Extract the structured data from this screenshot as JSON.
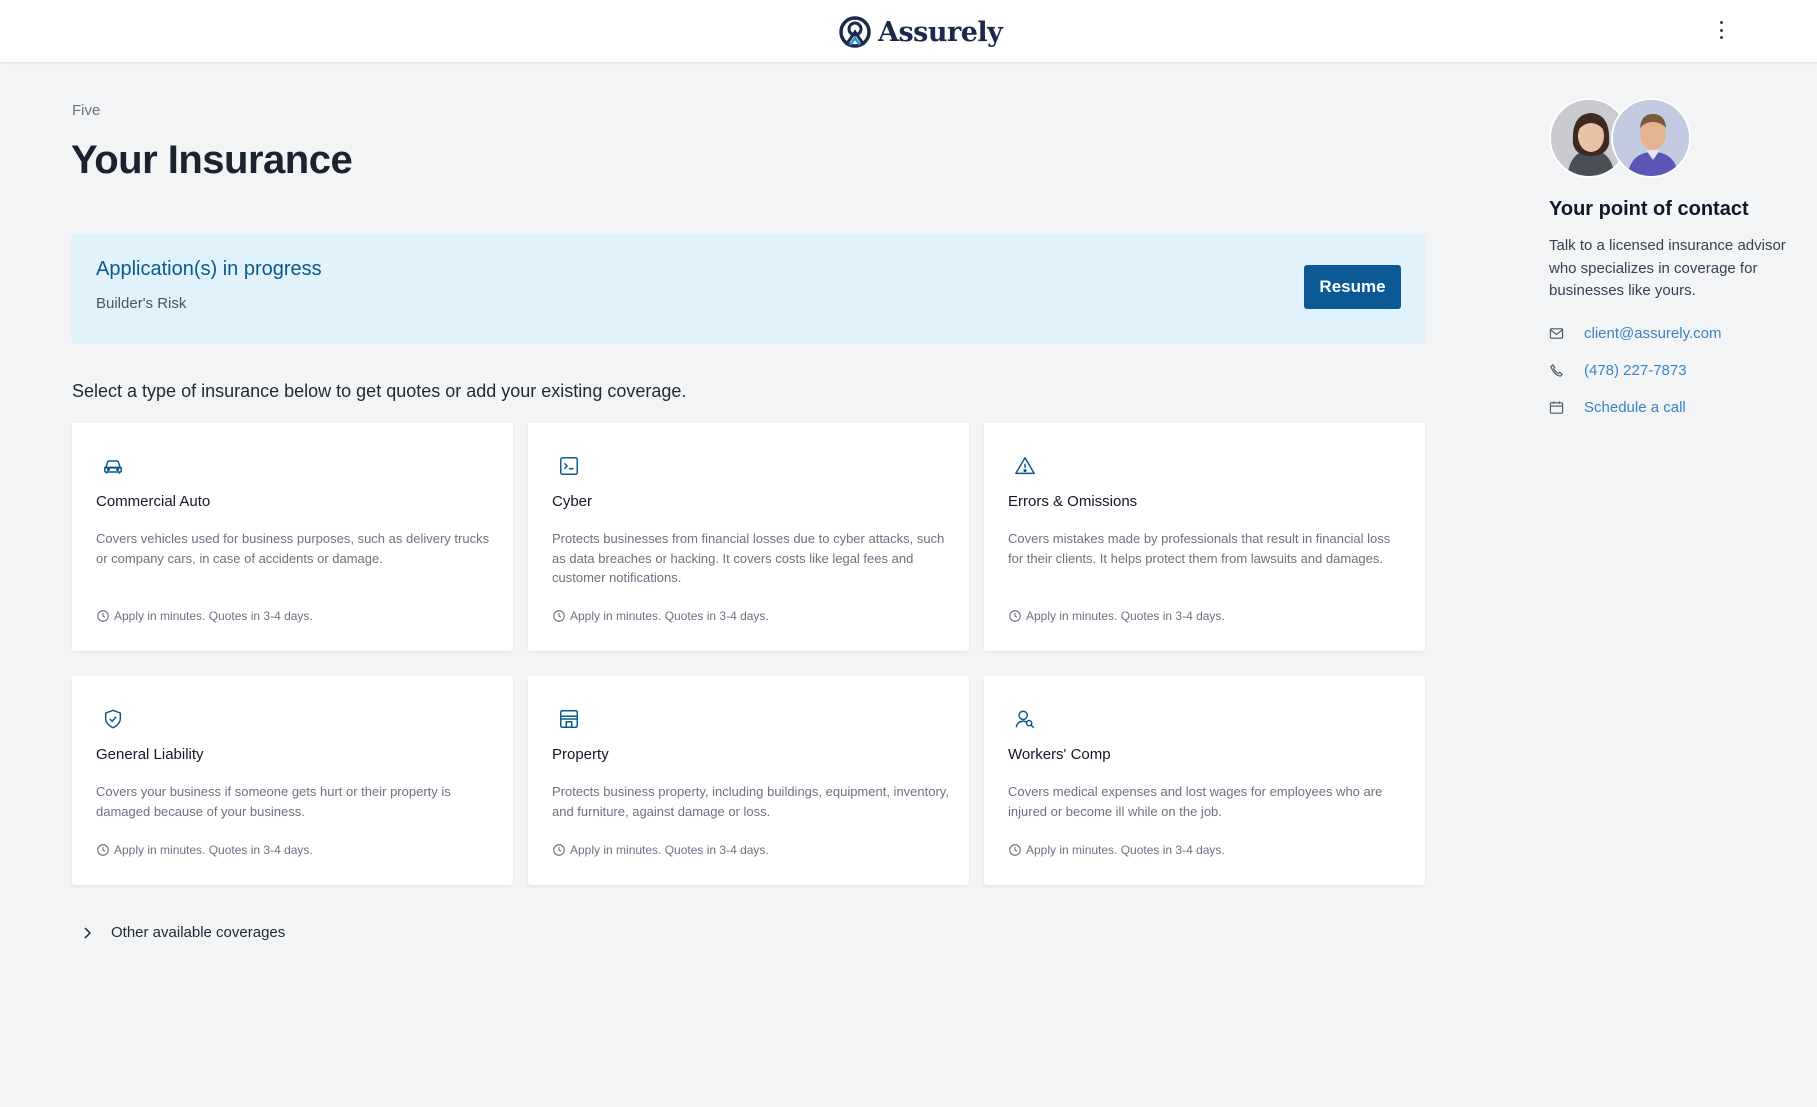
{
  "brand": {
    "name": "Assurely",
    "color": "#1b2a4a",
    "accent": "#0b5a96"
  },
  "header": {
    "menu_icon": "kebab-menu-icon"
  },
  "page": {
    "eyebrow": "Five",
    "title": "Your Insurance"
  },
  "in_progress": {
    "title": "Application(s) in progress",
    "subtitle": "Builder's Risk",
    "resume_label": "Resume"
  },
  "prompt": "Select a type of insurance below to get quotes or add your existing coverage.",
  "coverages": [
    {
      "icon": "car-icon",
      "title": "Commercial Auto",
      "description": "Covers vehicles used for business purposes, such as delivery trucks or company cars, in case of accidents or damage.",
      "footer": "Apply in minutes. Quotes in 3-4 days."
    },
    {
      "icon": "terminal-icon",
      "title": "Cyber",
      "description": "Protects businesses from financial losses due to cyber attacks, such as data breaches or hacking. It covers costs like legal fees and customer notifications.",
      "footer": "Apply in minutes. Quotes in 3-4 days."
    },
    {
      "icon": "warning-icon",
      "title": "Errors & Omissions",
      "description": "Covers mistakes made by professionals that result in financial loss for their clients. It helps protect them from lawsuits and damages.",
      "footer": "Apply in minutes. Quotes in 3-4 days."
    },
    {
      "icon": "shield-check-icon",
      "title": "General Liability",
      "description": "Covers your business if someone gets hurt or their property is damaged because of your business.",
      "footer": "Apply in minutes. Quotes in 3-4 days."
    },
    {
      "icon": "storefront-icon",
      "title": "Property",
      "description": "Protects business property, including buildings, equipment, inventory, and furniture, against damage or loss.",
      "footer": "Apply in minutes. Quotes in 3-4 days."
    },
    {
      "icon": "worker-icon",
      "title": "Workers' Comp",
      "description": "Covers medical expenses and lost wages for employees who are injured or become ill while on the job.",
      "footer": "Apply in minutes. Quotes in 3-4 days."
    }
  ],
  "other_coverages": {
    "label": "Other available coverages"
  },
  "contact": {
    "title": "Your point of contact",
    "description": "Talk to a licensed insurance advisor who specializes in coverage for businesses like yours.",
    "email": "client@assurely.com",
    "phone": "(478) 227-7873",
    "schedule": "Schedule a call"
  }
}
